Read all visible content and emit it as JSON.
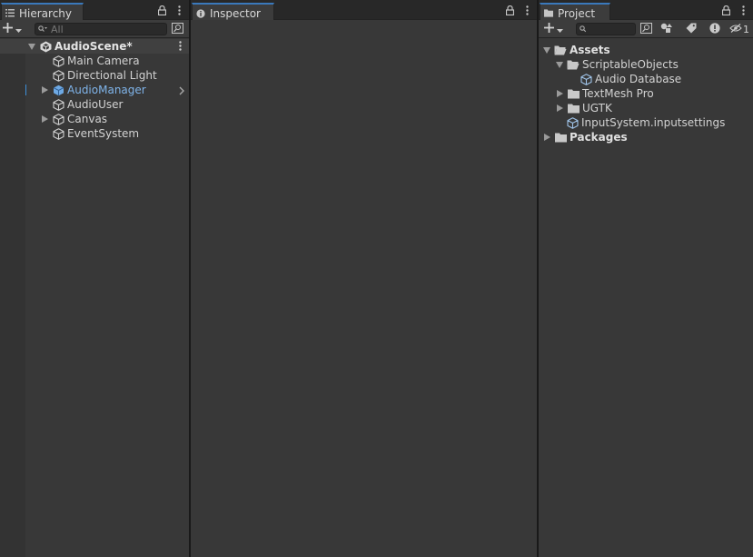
{
  "hierarchy": {
    "tab_label": "Hierarchy",
    "search_placeholder": "All",
    "scene": {
      "label": "AudioScene*"
    },
    "items": [
      {
        "label": "Main Camera",
        "has_children": false,
        "selected": false
      },
      {
        "label": "Directional Light",
        "has_children": false,
        "selected": false
      },
      {
        "label": "AudioManager",
        "has_children": true,
        "selected": true
      },
      {
        "label": "AudioUser",
        "has_children": false,
        "selected": false
      },
      {
        "label": "Canvas",
        "has_children": true,
        "selected": false
      },
      {
        "label": "EventSystem",
        "has_children": false,
        "selected": false
      }
    ]
  },
  "inspector": {
    "tab_label": "Inspector"
  },
  "project": {
    "tab_label": "Project",
    "hidden_count": "1",
    "tree": {
      "assets": "Assets",
      "scriptable_objects": "ScriptableObjects",
      "audio_database": "Audio Database",
      "textmesh_pro": "TextMesh Pro",
      "ugtk": "UGTK",
      "input_settings": "InputSystem.inputsettings",
      "packages": "Packages"
    }
  },
  "colors": {
    "panel_bg": "#383838",
    "tab_accent": "#3a79bb",
    "selection_text": "#7fb4ea"
  }
}
